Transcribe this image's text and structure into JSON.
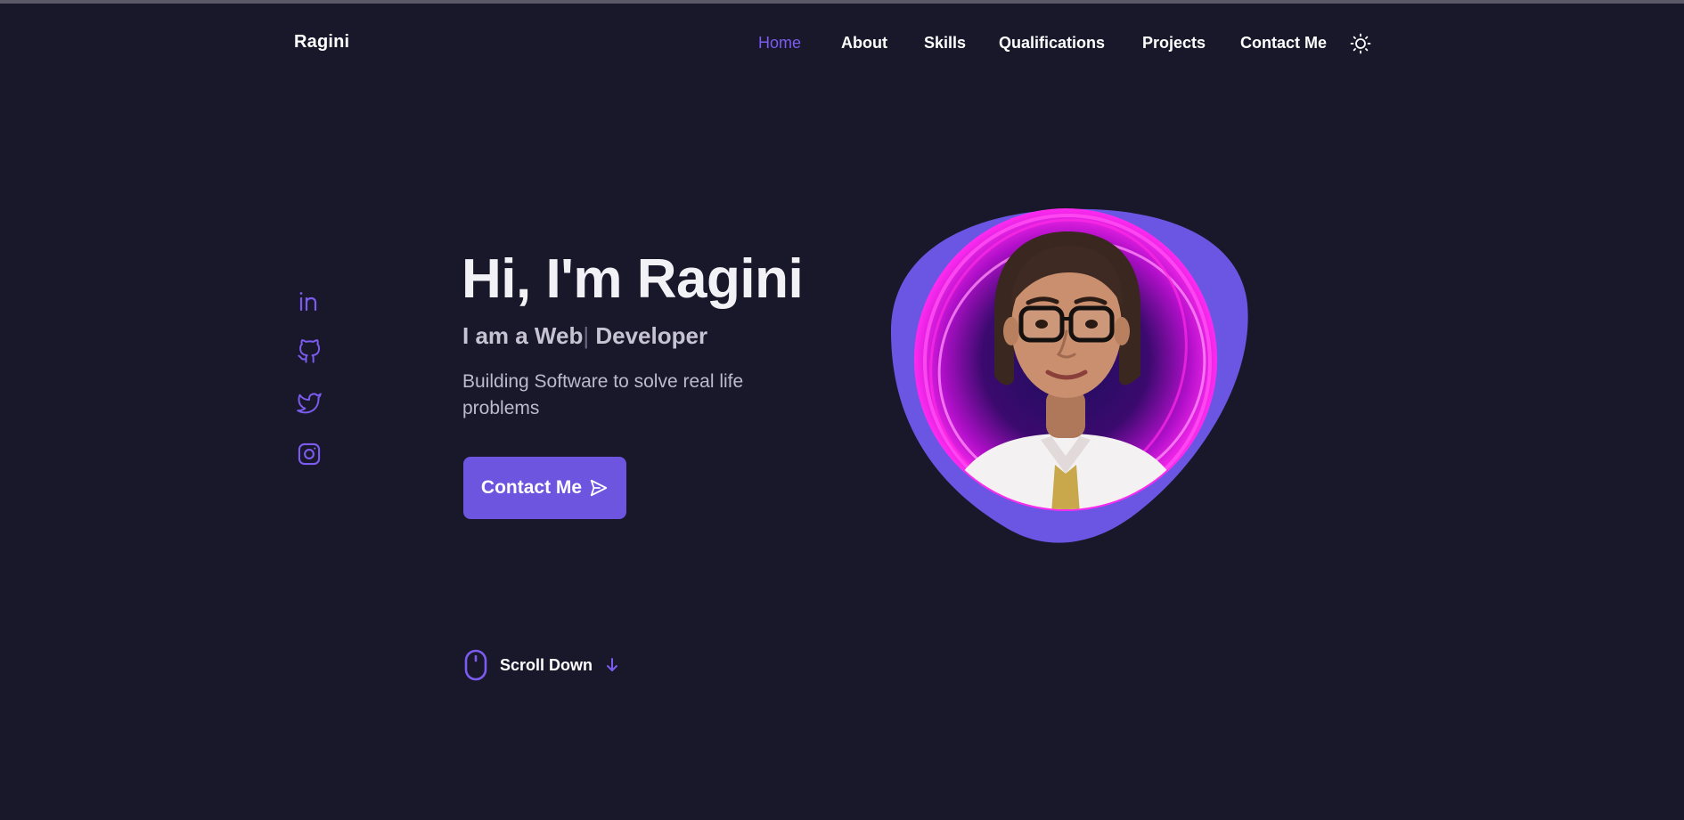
{
  "brand": {
    "name": "Ragini"
  },
  "nav": {
    "items": [
      {
        "label": "Home",
        "active": true
      },
      {
        "label": "About"
      },
      {
        "label": "Skills"
      },
      {
        "label": "Qualifications"
      },
      {
        "label": "Projects"
      },
      {
        "label": "Contact Me"
      }
    ],
    "theme_toggle_icon": "sun-icon"
  },
  "socials": [
    {
      "icon": "linkedin-icon"
    },
    {
      "icon": "github-icon"
    },
    {
      "icon": "twitter-icon"
    },
    {
      "icon": "instagram-icon"
    }
  ],
  "hero": {
    "title": "Hi, I'm Ragini",
    "subtitle_prefix": "I am a Web",
    "subtitle_caret": "|",
    "subtitle_suffix": " Developer",
    "description": "Building Software to solve real life problems",
    "cta_label": "Contact Me",
    "cta_icon": "send-icon"
  },
  "scroll": {
    "label": "Scroll Down",
    "mouse_icon": "mouse-icon",
    "arrow_icon": "arrow-down-icon"
  },
  "colors": {
    "background": "#19172a",
    "accent": "#6d55e0",
    "accent_text": "#7c5cf0",
    "blob": "#6a56e2",
    "neon": "#ff1ee8"
  }
}
